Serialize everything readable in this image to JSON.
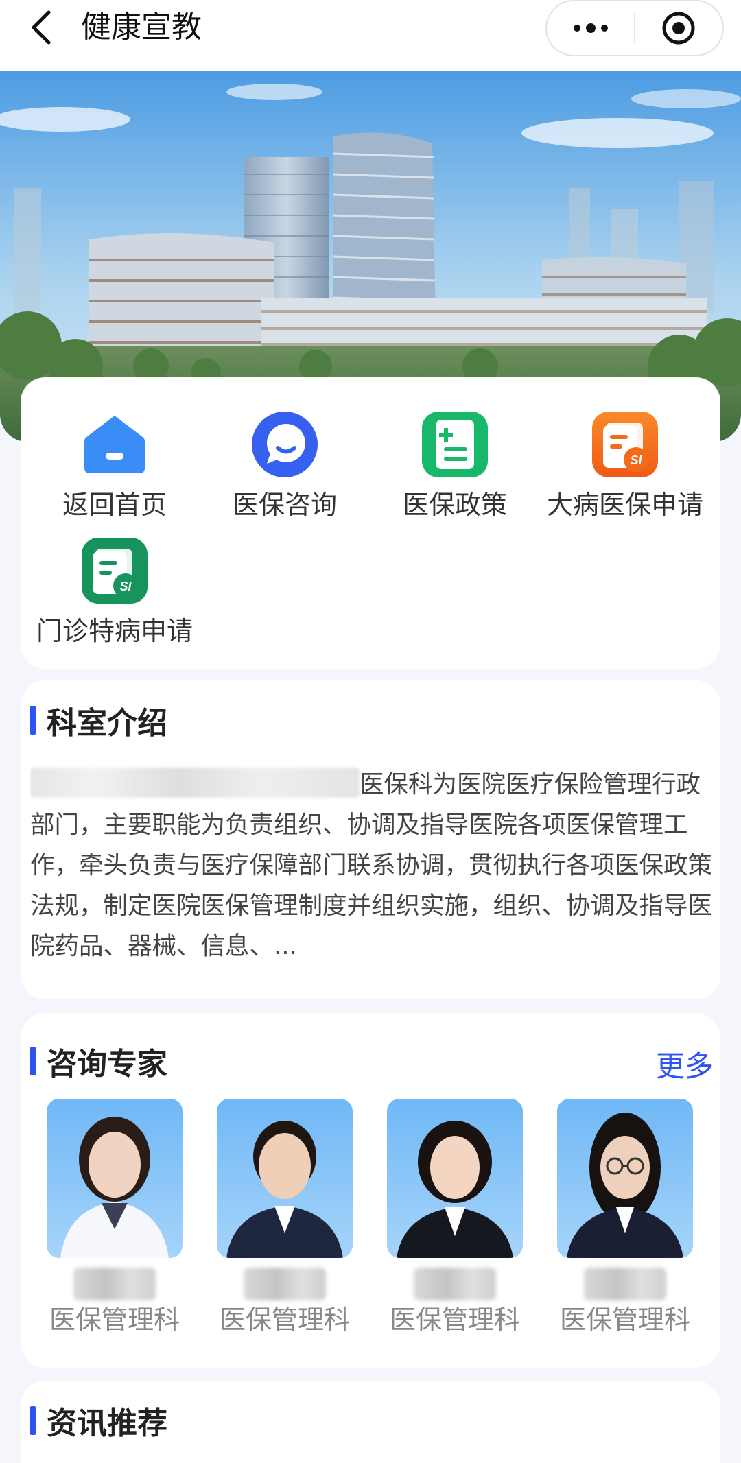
{
  "header": {
    "title": "健康宣教",
    "back_icon": "chevron-left-icon",
    "more_icon": "more-dots-icon",
    "close_icon": "target-close-icon"
  },
  "banner": {
    "description": "hospital-building-banner"
  },
  "quick_links": [
    {
      "label": "返回首页",
      "icon": "home-icon",
      "color": "#3a8cf6"
    },
    {
      "label": "医保咨询",
      "icon": "chat-bubble-icon",
      "color": "#3560f0"
    },
    {
      "label": "医保政策",
      "icon": "policy-document-icon",
      "color": "#18b86a"
    },
    {
      "label": "大病医保申请",
      "icon": "insurance-form-icon",
      "color": "#f46a1b"
    },
    {
      "label": "门诊特病申请",
      "icon": "insurance-form-icon",
      "color": "#17935e"
    }
  ],
  "intro": {
    "title": "科室介绍",
    "text": "医保科为医院医疗保险管理行政部门，主要职能为负责组织、协调及指导医院各项医保管理工作，牵头负责与医疗保障部门联系协调，贯彻执行各项医保政策法规，制定医院医保管理制度并组织实施，组织、协调及指导医院药品、器械、信息、..."
  },
  "experts": {
    "title": "咨询专家",
    "more_label": "更多",
    "items": [
      {
        "dept": "医保管理科",
        "coat": "white"
      },
      {
        "dept": "医保管理科",
        "coat": "dark"
      },
      {
        "dept": "医保管理科",
        "coat": "dark"
      },
      {
        "dept": "医保管理科",
        "coat": "dark"
      }
    ]
  },
  "news": {
    "title": "资讯推荐"
  },
  "colors": {
    "accent": "#2d54f0",
    "background": "#f4f6fb"
  }
}
